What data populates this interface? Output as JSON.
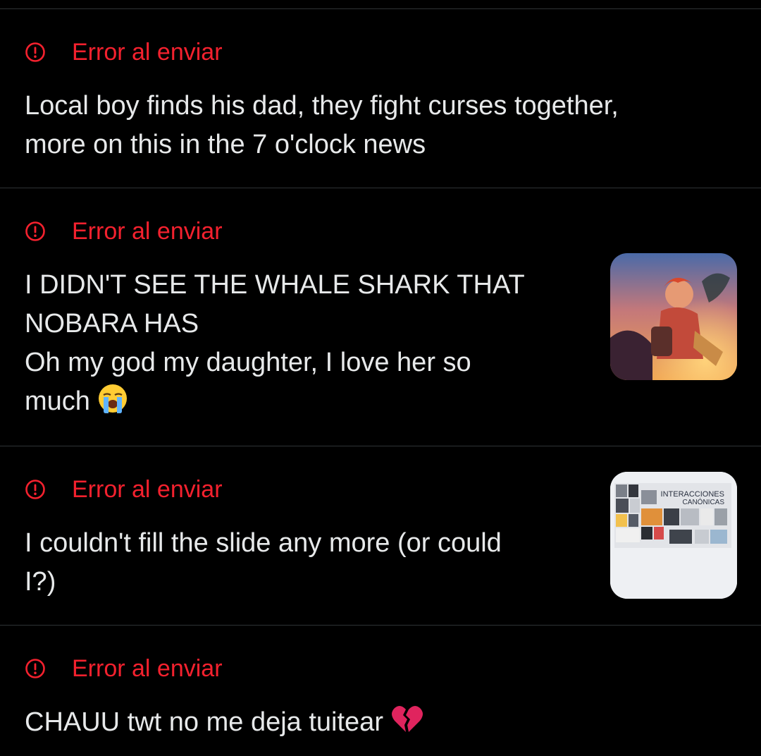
{
  "drafts": [
    {
      "error_label": "Error al enviar",
      "text": "Local boy finds his dad, they fight curses together,\nmore on this in the 7 o'clock news",
      "emoji": ""
    },
    {
      "error_label": "Error al enviar",
      "text": "I DIDN'T SEE THE WHALE SHARK THAT\nNOBARA HAS\nOh my god my daughter, I love her so\nmuch",
      "emoji": "loudly-crying-face-emoji",
      "thumbnail": "anime-illustration"
    },
    {
      "error_label": "Error al enviar",
      "text": "I couldn't fill the slide any more (or could\nI?)",
      "emoji": "",
      "thumbnail": "slide-collage",
      "thumbnail_title_line1": "INTERACCIONES",
      "thumbnail_title_line2": "CANÓNICAS"
    },
    {
      "error_label": "Error al enviar",
      "text": "CHAUU twt no me deja tuitear",
      "emoji": "broken-heart-emoji"
    }
  ],
  "colors": {
    "background": "#000000",
    "text": "#e7e9ea",
    "error": "#f4212e",
    "divider": "#2f3336"
  },
  "icons": {
    "error": "error-circle-icon"
  }
}
